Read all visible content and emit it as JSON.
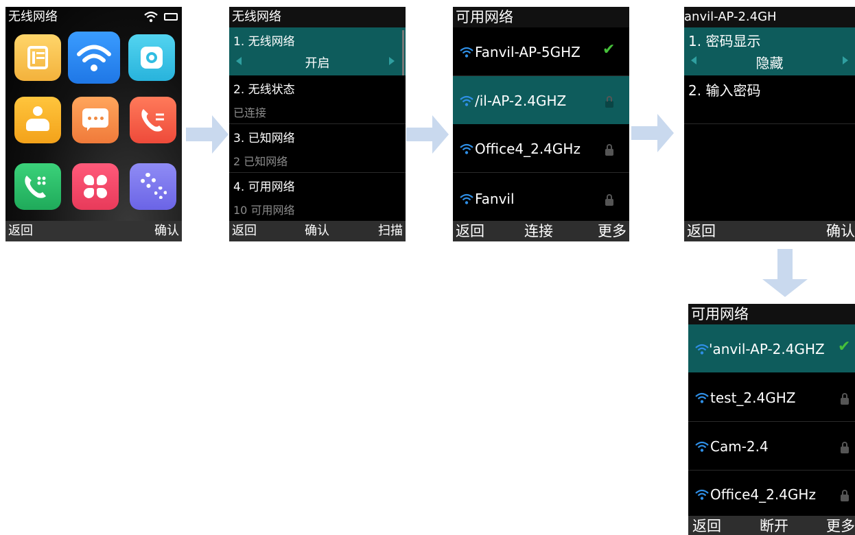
{
  "screen1": {
    "title": "无线网络",
    "soft_left": "返回",
    "soft_right": "确认",
    "icons": [
      "contacts-book-icon",
      "wifi-icon",
      "settings-icon",
      "user-icon",
      "message-icon",
      "call-log-icon",
      "dialpad-icon",
      "apps-icon",
      "advanced-settings-icon"
    ]
  },
  "screen2": {
    "title": "无线网络",
    "items": [
      {
        "label": "1. 无线网络",
        "value": "开启"
      },
      {
        "label": "2. 无线状态",
        "value": "已连接"
      },
      {
        "label": "3. 已知网络",
        "value": "2 已知网络"
      },
      {
        "label": "4. 可用网络",
        "value": "10 可用网络"
      }
    ],
    "soft_left": "返回",
    "soft_mid": "确认",
    "soft_right": "扫描"
  },
  "screen3": {
    "title": "可用网络",
    "networks": [
      "Fanvil-AP-5GHZ",
      "/il-AP-2.4GHZ",
      "Office4_2.4GHz",
      "Fanvil"
    ],
    "soft_left": "返回",
    "soft_mid": "连接",
    "soft_right": "更多"
  },
  "screen4": {
    "title": "anvil-AP-2.4GH",
    "items": [
      {
        "label": "1. 密码显示",
        "value": "隐藏"
      },
      {
        "label": "2. 输入密码"
      }
    ],
    "soft_left": "返回",
    "soft_right": "确认"
  },
  "screen5": {
    "title": "可用网络",
    "networks": [
      "'anvil-AP-2.4GHZ",
      "test_2.4GHZ",
      "Cam-2.4",
      "Office4_2.4GHz"
    ],
    "soft_left": "返回",
    "soft_mid": "断开",
    "soft_right": "更多"
  },
  "colors": {
    "highlight": "#0e5c5c",
    "arrow": "#c9d9ee",
    "check": "#46c03a",
    "wifi": "#2f8fe6"
  }
}
